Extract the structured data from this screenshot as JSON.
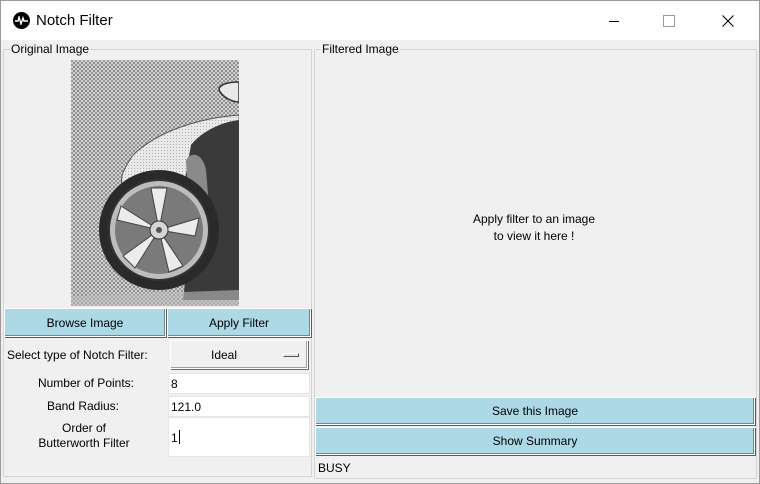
{
  "window": {
    "title": "Notch Filter",
    "controls": {
      "minimize": "minimize-icon",
      "maximize": "maximize-icon",
      "close": "close-icon"
    }
  },
  "original_panel": {
    "label": "Original Image",
    "image": "car-wheel-image",
    "browse_label": "Browse Image",
    "apply_label": "Apply Filter"
  },
  "form": {
    "filter_type_label": "Select type of Notch Filter:",
    "filter_type_value": "Ideal",
    "points_label": "Number of Points:",
    "points_value": "8",
    "radius_label": "Band Radius:",
    "radius_value": "121.0",
    "order_label_line1": "Order of",
    "order_label_line2": "Butterworth Filter",
    "order_value": "1"
  },
  "filtered_panel": {
    "label": "Filtered Image",
    "placeholder_line1": "Apply filter to an image",
    "placeholder_line2": "to view it here !",
    "save_label": "Save this Image",
    "summary_label": "Show Summary",
    "status": "BUSY"
  },
  "colors": {
    "button_bg": "#add8e6",
    "panel_bg": "#f0f0f0"
  }
}
